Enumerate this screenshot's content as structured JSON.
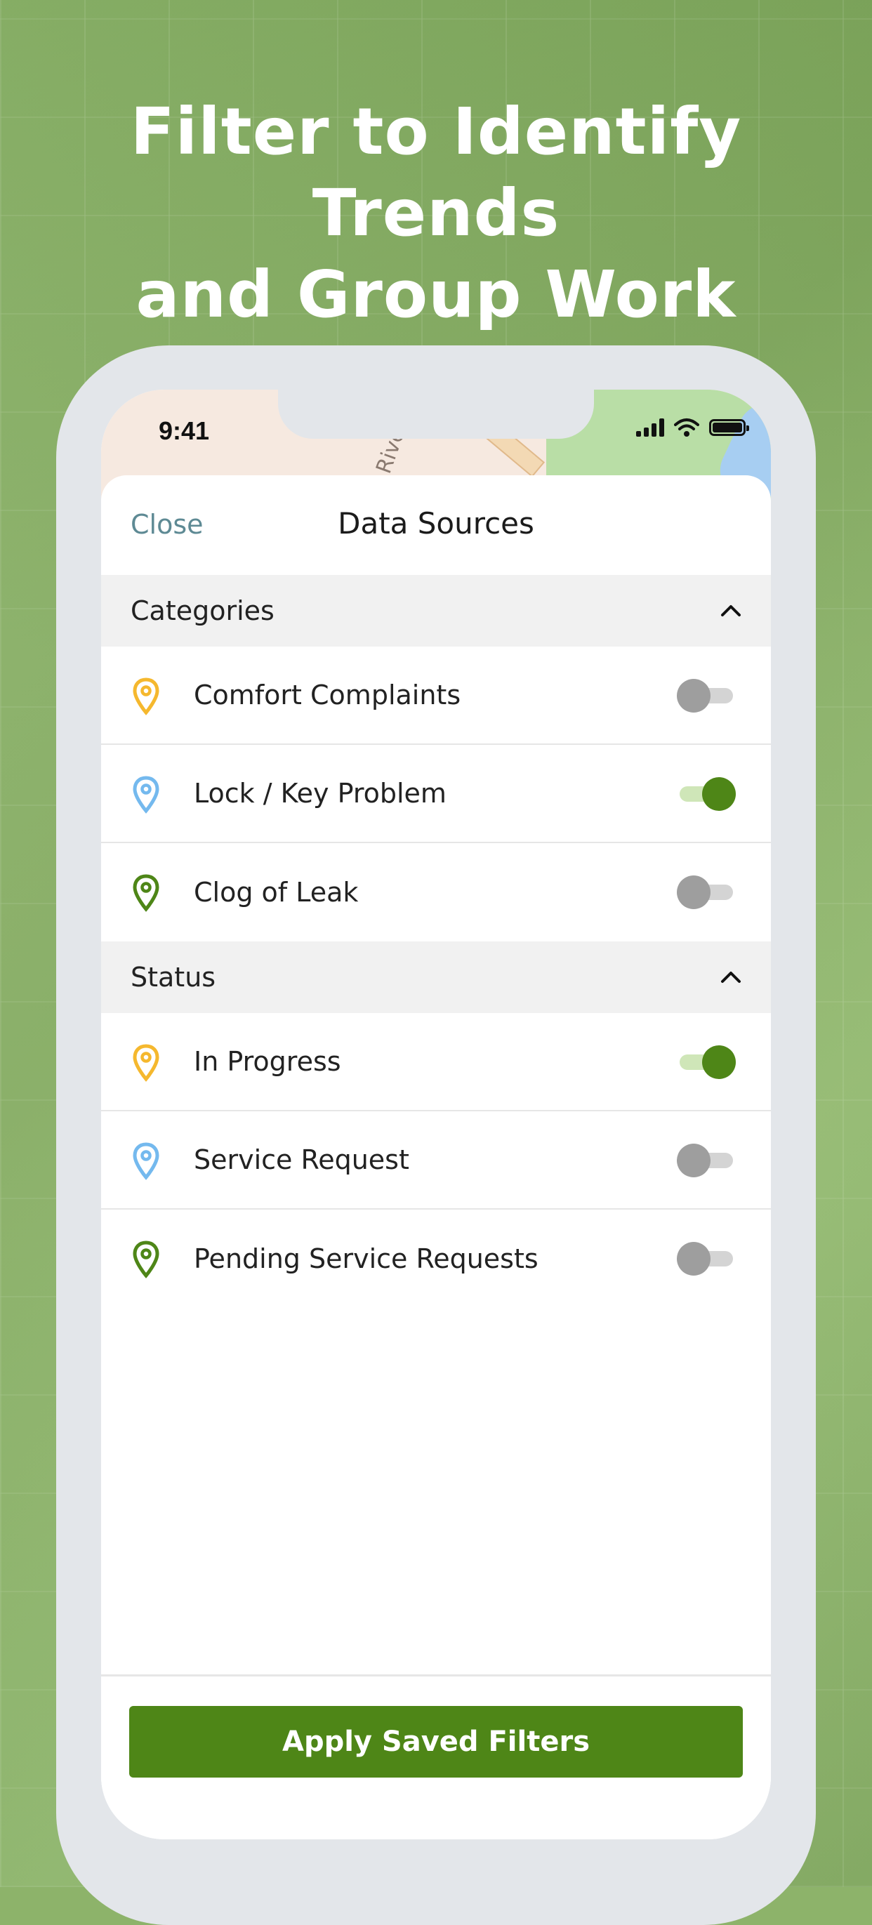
{
  "headline": {
    "line1": "Filter to Identify Trends",
    "line2": "and Group Work Orders"
  },
  "status_bar": {
    "time": "9:41"
  },
  "map": {
    "street_text": "Rive"
  },
  "header": {
    "close_label": "Close",
    "title": "Data Sources"
  },
  "sections": [
    {
      "title": "Categories",
      "items": [
        {
          "label": "Comfort Complaints",
          "pin_color": "#f5b82e",
          "enabled": false
        },
        {
          "label": "Lock / Key Problem",
          "pin_color": "#74b9ee",
          "enabled": true
        },
        {
          "label": "Clog of Leak",
          "pin_color": "#4e8617",
          "enabled": false
        }
      ]
    },
    {
      "title": "Status",
      "items": [
        {
          "label": "In Progress",
          "pin_color": "#f5b82e",
          "enabled": true
        },
        {
          "label": "Service Request",
          "pin_color": "#74b9ee",
          "enabled": false
        },
        {
          "label": "Pending Service Requests",
          "pin_color": "#4e8617",
          "enabled": false
        }
      ]
    }
  ],
  "footer": {
    "apply_label": "Apply Saved Filters"
  },
  "colors": {
    "accent": "#4e8617",
    "background": "#8db36a",
    "close_link": "#5e8a94"
  }
}
